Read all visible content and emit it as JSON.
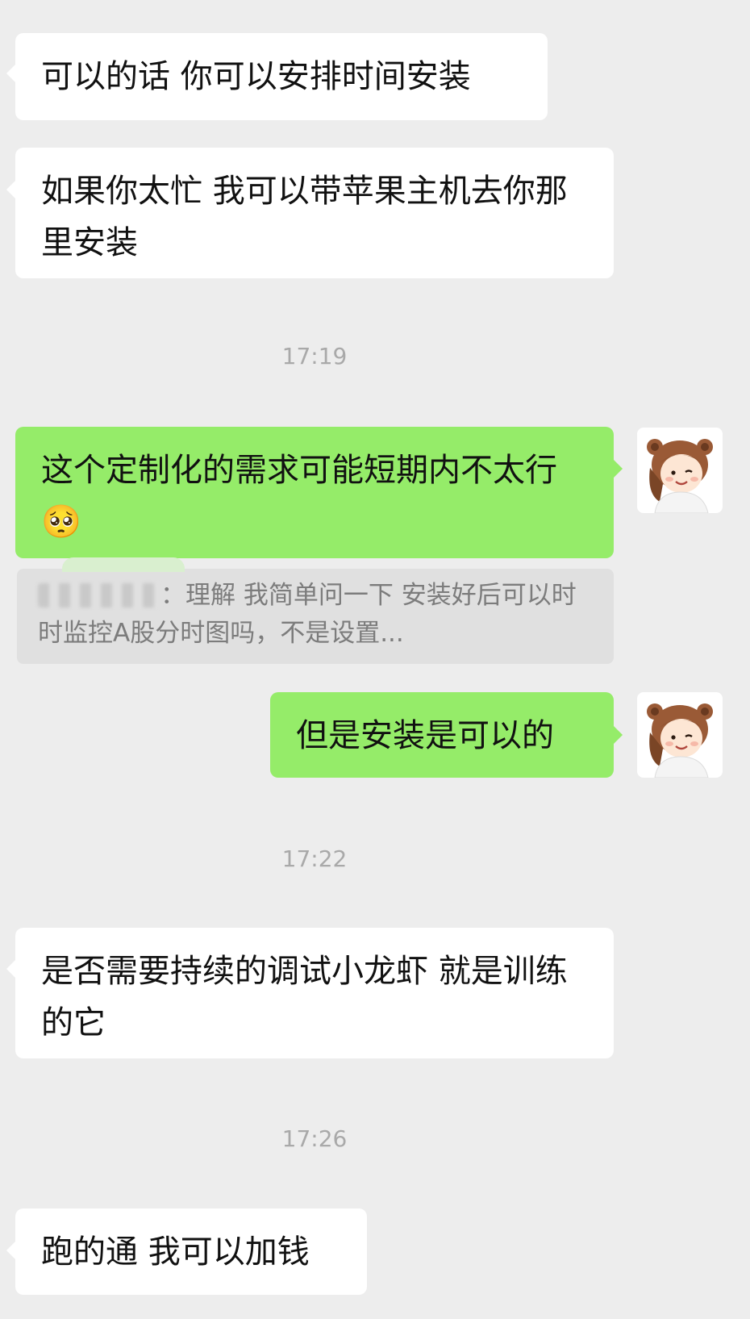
{
  "messages": [
    {
      "side": "left",
      "text": "可以的话 你可以安排时间安装"
    },
    {
      "side": "left",
      "text": "如果你太忙 我可以带苹果主机去你那里安装"
    },
    {
      "side": "right",
      "text": "这个定制化的需求可能短期内不太行",
      "emoji": "🥺"
    },
    {
      "side": "right",
      "text": "但是安装是可以的"
    },
    {
      "side": "left",
      "text": "是否需要持续的调试小龙虾 就是训练的它"
    },
    {
      "side": "left",
      "text": "跑的通 我可以加钱"
    }
  ],
  "quote": {
    "text": "：理解 我简单问一下 安装好后可以时时监控A股分时图吗，不是设置..."
  },
  "timestamps": [
    "17:19",
    "17:22",
    "17:26"
  ],
  "avatar": {
    "icon": "bear-hat-girl-avatar-icon"
  },
  "colors": {
    "background": "#ededed",
    "incoming_bubble": "#ffffff",
    "outgoing_bubble": "#95ec69",
    "timestamp": "#a9a9a9"
  }
}
